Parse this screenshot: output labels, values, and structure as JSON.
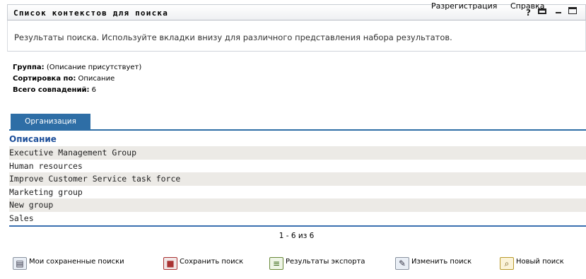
{
  "header": {
    "title": "Список контекстов для поиска",
    "unregister_link": "Разрегистрация",
    "help_link": "Справка"
  },
  "description": "Результаты поиска. Используйте вкладки внизу для различного представления набора результатов.",
  "meta": {
    "group_label": "Группа:",
    "group_value": "(Описание присутствует)",
    "sort_label": "Сортировка по:",
    "sort_value": "Описание",
    "total_label": "Всего совпадений:",
    "total_value": "6"
  },
  "tabs": [
    {
      "label": "Организация"
    }
  ],
  "table": {
    "column_header": "Описание",
    "rows": [
      "Executive Management Group",
      "Human resources",
      "Improve Customer Service task force",
      "Marketing group",
      "New group",
      "Sales"
    ]
  },
  "pager": "1 - 6 из 6",
  "actions": [
    {
      "label": "Мои сохраненные поиски",
      "icon": "saved-searches-icon"
    },
    {
      "label": "Сохранить поиск",
      "icon": "floppy-disk-icon"
    },
    {
      "label": "Результаты экспорта",
      "icon": "export-icon"
    },
    {
      "label": "Изменить поиск",
      "icon": "edit-tools-icon"
    },
    {
      "label": "Новый поиск",
      "icon": "magnifier-icon"
    }
  ],
  "colors": {
    "tab_blue": "#2e6ea6",
    "header_link_blue": "#1d4f9a",
    "row_stripe": "#eceae6"
  }
}
